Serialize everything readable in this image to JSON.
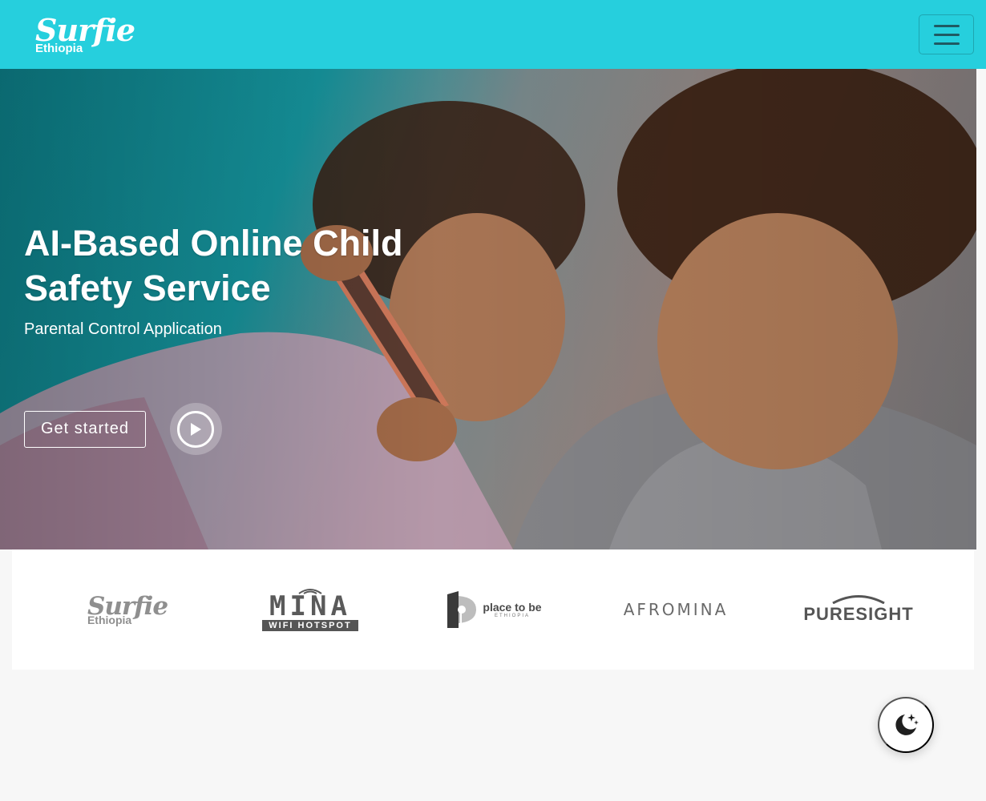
{
  "header": {
    "brand_main": "Surfie",
    "brand_sub": "Ethiopia",
    "menu_icon": "hamburger-menu-icon",
    "color": "#26cfdd"
  },
  "hero": {
    "title": "AI-Based Online Child Safety Service",
    "subtitle": "Parental Control Application",
    "cta_label": "Get started",
    "play_icon": "play-icon"
  },
  "clients": [
    {
      "name": "Surfie Ethiopia",
      "main": "Surfie",
      "sub": "Ethiopia"
    },
    {
      "name": "Mina WiFi Hotspot",
      "main": "MINA",
      "sub": "WIFI HOTSPOT"
    },
    {
      "name": "Place to be Ethiopia",
      "main": "place to be",
      "sub": "ETHIOPIA"
    },
    {
      "name": "Afromina",
      "main": "AFROMINA"
    },
    {
      "name": "PureSight",
      "main": "PURESIGHT"
    }
  ],
  "theme_toggle": {
    "icon": "moon-stars-icon"
  }
}
